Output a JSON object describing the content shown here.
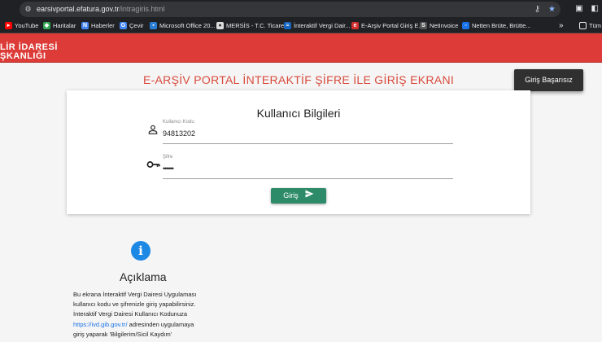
{
  "browser": {
    "url_host": "earsivportal.efatura.gov.tr",
    "url_path": "/intragiris.html",
    "bookmarks": [
      {
        "label": "YouTube",
        "color": "#ff0000"
      },
      {
        "label": "Haritalar",
        "color": "#34a853"
      },
      {
        "label": "Haberler",
        "color": "#4285f4"
      },
      {
        "label": "Çevir",
        "color": "#4285f4"
      },
      {
        "label": "Microsoft Office 20...",
        "color": "#2b7cd3"
      },
      {
        "label": "MERSİS - T.C. Ticare...",
        "color": "#dddddd"
      },
      {
        "label": "İnteraktif Vergi Dair...",
        "color": "#1565c0"
      },
      {
        "label": "E-Arşiv Portal Giriş E...",
        "color": "#d32f2f"
      },
      {
        "label": "NetInvoice",
        "color": "#555555"
      },
      {
        "label": "Netten Brüte, Brütte...",
        "color": "#1a73e8"
      }
    ],
    "more_label": "»",
    "folder_label": "Tüm"
  },
  "header": {
    "logo_line1": "LİR İDARESİ",
    "logo_line2": "ŞKANLIĞI",
    "color": "#dc3b37"
  },
  "page": {
    "title": "E-ARŞİV PORTAL İNTERAKTİF ŞİFRE İLE GİRİŞ EKRANI",
    "error_button": "Giriş Başarısız"
  },
  "login": {
    "card_title": "Kullanıcı Bilgileri",
    "username_label": "Kullanıcı Kodu",
    "username_value": "94813202",
    "password_label": "Şifre",
    "password_value": "••••••",
    "submit_label": "Giriş"
  },
  "info": {
    "title": "Açıklama",
    "line1": "Bu ekrana İnteraktif Vergi Dairesi Uygulaması",
    "line2": "kullanıcı kodu ve şifrenizle giriş yapabilirsiniz.",
    "line3": "İnteraktif Vergi Dairesi Kullanıcı Kodunuza",
    "link": "https://ivd.gib.gov.tr/",
    "line4_rest": " adresinden uygulamaya",
    "line5": "giriş yaparak 'Bilgilerim/Sicil Kaydım'"
  }
}
